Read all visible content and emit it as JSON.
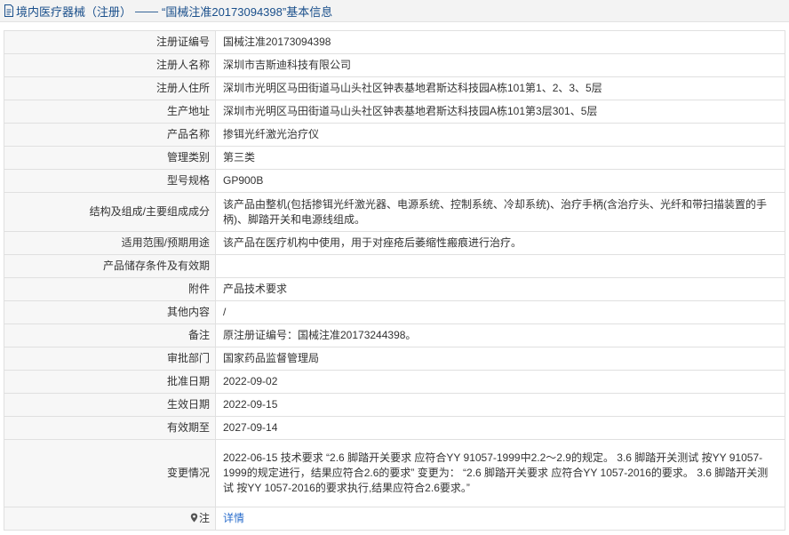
{
  "header": {
    "title_part1": "境内医疗器械（注册）",
    "separator": "——",
    "title_part2": "“国械注准20173094398”基本信息"
  },
  "rows": [
    {
      "label": "注册证编号",
      "value": "国械注准20173094398"
    },
    {
      "label": "注册人名称",
      "value": "深圳市吉斯迪科技有限公司"
    },
    {
      "label": "注册人住所",
      "value": "深圳市光明区马田街道马山头社区钟表基地君斯达科技园A栋101第1、2、3、5层"
    },
    {
      "label": "生产地址",
      "value": "深圳市光明区马田街道马山头社区钟表基地君斯达科技园A栋101第3层301、5层"
    },
    {
      "label": "产品名称",
      "value": "掺铒光纤激光治疗仪"
    },
    {
      "label": "管理类别",
      "value": "第三类"
    },
    {
      "label": "型号规格",
      "value": "GP900B"
    },
    {
      "label": "结构及组成/主要组成成分",
      "value": "该产品由整机(包括掺铒光纤激光器、电源系统、控制系统、冷却系统)、治疗手柄(含治疗头、光纤和带扫描装置的手柄)、脚踏开关和电源线组成。"
    },
    {
      "label": "适用范围/预期用途",
      "value": "该产品在医疗机构中使用，用于对痤疮后萎缩性瘢痕进行治疗。"
    },
    {
      "label": "产品储存条件及有效期",
      "value": ""
    },
    {
      "label": "附件",
      "value": "产品技术要求"
    },
    {
      "label": "其他内容",
      "value": "/"
    },
    {
      "label": "备注",
      "value": "原注册证编号：国械注准20173244398。"
    },
    {
      "label": "审批部门",
      "value": "国家药品监督管理局"
    },
    {
      "label": "批准日期",
      "value": "2022-09-02"
    },
    {
      "label": "生效日期",
      "value": "2022-09-15"
    },
    {
      "label": "有效期至",
      "value": "2027-09-14"
    },
    {
      "label": "变更情况",
      "value": "2022-06-15 技术要求 “2.6 脚踏开关要求 应符合YY 91057-1999中2.2～2.9的规定。 3.6 脚踏开关测试 按YY 91057-1999的规定进行，结果应符合2.6的要求” 变更为： “2.6 脚踏开关要求 应符合YY 1057-2016的要求。 3.6 脚踏开关测试 按YY 1057-2016的要求执行,结果应符合2.6要求。”"
    }
  ],
  "note": {
    "label": "注",
    "link_text": "详情",
    "icon": "location-pin-icon"
  },
  "colors": {
    "header_text": "#1a4f8b",
    "link": "#2a6dcc",
    "label_bg": "#f7f7f7",
    "border": "#e0e0e0"
  }
}
